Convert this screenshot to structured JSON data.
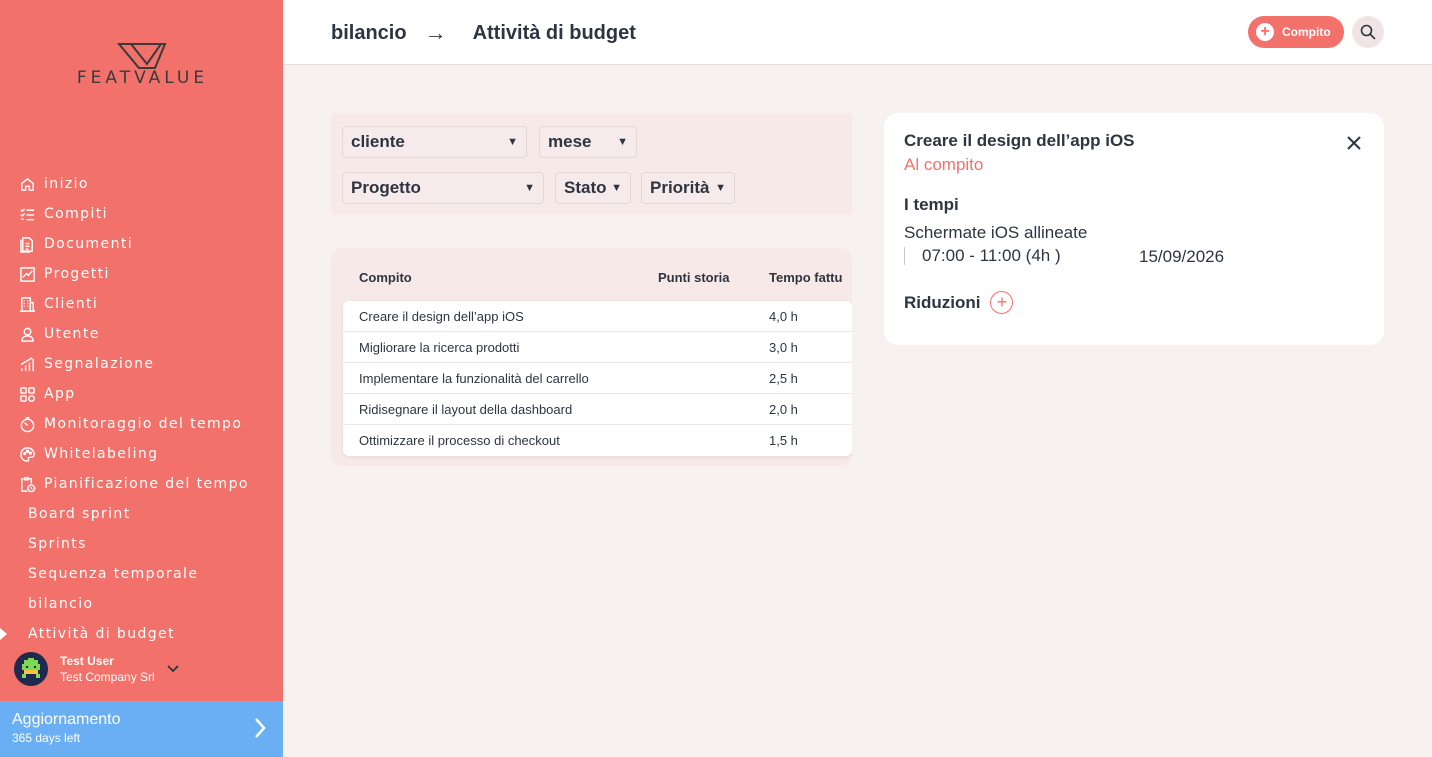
{
  "brand": {
    "logo_text": "FEATVALUE"
  },
  "sidebar": {
    "items": [
      {
        "label": "inizio",
        "icon": "home-icon"
      },
      {
        "label": "Compiti",
        "icon": "checklist-icon"
      },
      {
        "label": "Documenti",
        "icon": "document-icon"
      },
      {
        "label": "Progetti",
        "icon": "chart-icon"
      },
      {
        "label": "Clienti",
        "icon": "building-icon"
      },
      {
        "label": "Utente",
        "icon": "user-icon"
      },
      {
        "label": "Segnalazione",
        "icon": "bars-icon"
      },
      {
        "label": "App",
        "icon": "apps-icon"
      },
      {
        "label": "Monitoraggio del tempo",
        "icon": "stopwatch-icon"
      },
      {
        "label": "Whitelabeling",
        "icon": "palette-icon"
      },
      {
        "label": "Pianificazione del tempo",
        "icon": "clipboard-clock-icon"
      }
    ],
    "sub_items": [
      {
        "label": "Board sprint"
      },
      {
        "label": "Sprints"
      },
      {
        "label": "Sequenza temporale"
      },
      {
        "label": "bilancio"
      },
      {
        "label": "Attività di budget"
      }
    ],
    "user": {
      "name": "Test User",
      "company": "Test Company Srl"
    },
    "upgrade": {
      "title": "Aggiornamento",
      "subtitle": "365 days left"
    }
  },
  "header": {
    "breadcrumb_parent": "bilancio",
    "breadcrumb_arrow": "→",
    "breadcrumb_current": "Attività di budget",
    "add_task_label": "Compito"
  },
  "filters": {
    "client": "cliente",
    "month": "mese",
    "project": "Progetto",
    "status": "Stato",
    "priority": "Priorità"
  },
  "table": {
    "columns": [
      "Compito",
      "Punti storia",
      "Tempo fattu"
    ],
    "rows": [
      {
        "task": "Creare il design dell’app iOS",
        "points": "",
        "time": "4,0 h"
      },
      {
        "task": "Migliorare la ricerca prodotti",
        "points": "",
        "time": "3,0 h"
      },
      {
        "task": "Implementare la funzionalità del carrello",
        "points": "",
        "time": "2,5 h"
      },
      {
        "task": "Ridisegnare il layout della dashboard",
        "points": "",
        "time": "2,0 h"
      },
      {
        "task": "Ottimizzare il processo di checkout",
        "points": "",
        "time": "1,5 h"
      }
    ]
  },
  "detail": {
    "title": "Creare il design dell’app iOS",
    "link": "Al compito",
    "times_heading": "I tempi",
    "entry_name": "Schermate iOS allineate",
    "entry_time": "07:00 - 11:00 (4h )",
    "entry_date": "15/09/2026",
    "reductions_heading": "Riduzioni"
  },
  "colors": {
    "accent": "#f2726b",
    "upgrade": "#6aaef3"
  }
}
